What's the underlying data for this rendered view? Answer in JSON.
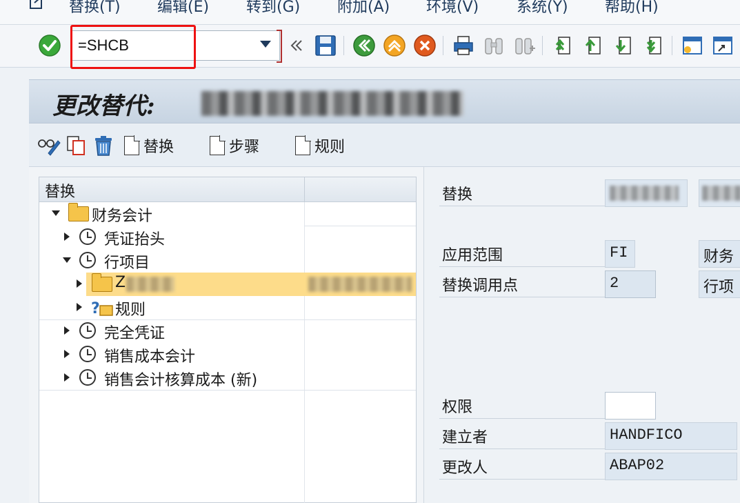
{
  "menu": {
    "items": [
      "替换(T)",
      "编辑(E)",
      "转到(G)",
      "附加(A)",
      "环境(V)",
      "系统(Y)",
      "帮助(H)"
    ]
  },
  "toolbar": {
    "command_value": "=SHCB"
  },
  "title": {
    "text": "更改替代:"
  },
  "app_toolbar": {
    "substitution_label": "替换",
    "step_label": "步骤",
    "rule_label": "规则"
  },
  "tree": {
    "header": "替换",
    "nodes": {
      "finance": "财务会计",
      "doc_header": "凭证抬头",
      "line_item": "行项目",
      "selected_prefix": "Z",
      "rules": "规则",
      "complete_doc": "完全凭证",
      "cost_of_sales": "销售成本会计",
      "cost_of_sales_new": "销售会计核算成本 (新)"
    }
  },
  "details": {
    "substitution_label": "替换",
    "app_area_label": "应用范围",
    "app_area_value": "FI",
    "app_area_desc": "财务",
    "call_point_label": "替换调用点",
    "call_point_value": "2",
    "call_point_desc": "行项",
    "auth_label": "权限",
    "auth_value": "",
    "created_by_label": "建立者",
    "created_by_value": "HANDFICO",
    "changed_by_label": "更改人",
    "changed_by_value": "ABAP02"
  },
  "colors": {
    "highlight": "#ee1111",
    "selected_row": "#fddc8a",
    "check_green": "#3aa83a"
  }
}
